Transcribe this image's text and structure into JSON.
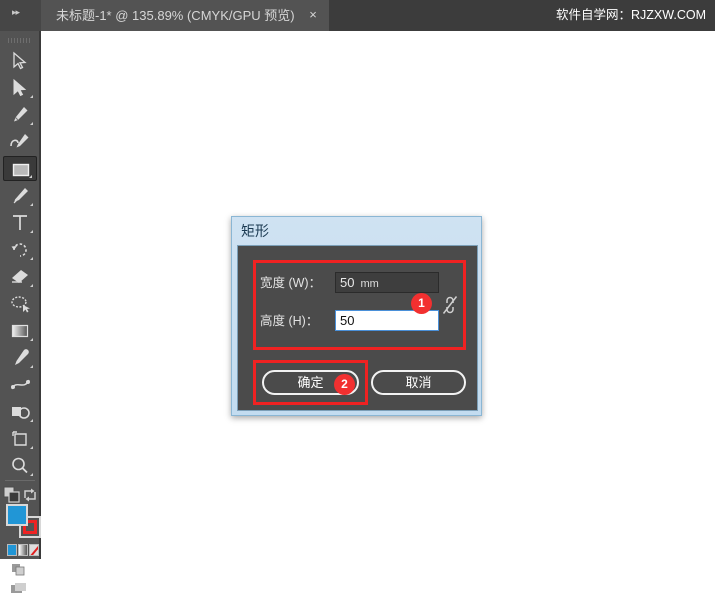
{
  "topbar": {
    "expand_icon": "double-chevron-right-icon",
    "tab_title": "未标题-1* @ 135.89% (CMYK/GPU 预览)",
    "tab_close": "×",
    "watermark": "软件自学网：RJZXW.COM"
  },
  "toolbar": {
    "tools": [
      {
        "name": "selection-tool",
        "label": "选择工具"
      },
      {
        "name": "direct-selection-tool",
        "label": "直接选择工具"
      },
      {
        "name": "pen-tool",
        "label": "钢笔工具"
      },
      {
        "name": "curvature-tool",
        "label": "曲率工具"
      },
      {
        "name": "rectangle-tool",
        "label": "矩形工具",
        "active": true
      },
      {
        "name": "paintbrush-tool",
        "label": "画笔工具"
      },
      {
        "name": "type-tool",
        "label": "文字工具"
      },
      {
        "name": "rotate-tool",
        "label": "旋转工具"
      },
      {
        "name": "eraser-tool",
        "label": "橡皮擦工具"
      },
      {
        "name": "shaper-tool",
        "label": "Shaper 工具"
      },
      {
        "name": "gradient-tool",
        "label": "渐变工具"
      },
      {
        "name": "eyedropper-tool",
        "label": "吸管工具"
      },
      {
        "name": "blend-tool",
        "label": "混合工具"
      },
      {
        "name": "shape-builder-tool",
        "label": "形状生成器工具"
      },
      {
        "name": "artboard-tool",
        "label": "画板工具"
      },
      {
        "name": "zoom-tool",
        "label": "缩放工具"
      }
    ],
    "arrange_icon": "arrange-squares-icon",
    "swap_icon": "swap-fill-stroke-icon",
    "fill_color": "#2196d6",
    "stroke_color": "#ee2222",
    "modes": [
      "color-mode",
      "gradient-mode",
      "none-mode"
    ],
    "drawing_mode_icon": "draw-normal-icon",
    "screen_mode_icon": "screen-mode-icon"
  },
  "dialog": {
    "title": "矩形",
    "fields": [
      {
        "label": "宽度 (W)：",
        "value": "50",
        "unit": "mm"
      },
      {
        "label": "高度 (H)：",
        "value": "50",
        "unit": ""
      }
    ],
    "link_icon": "broken-chain-link-icon",
    "buttons": {
      "ok": "确定",
      "cancel": "取消"
    },
    "annotations": [
      {
        "badge": "1",
        "target": "dimension-fields"
      },
      {
        "badge": "2",
        "target": "ok-button"
      }
    ],
    "accent_color": "#f02222"
  }
}
